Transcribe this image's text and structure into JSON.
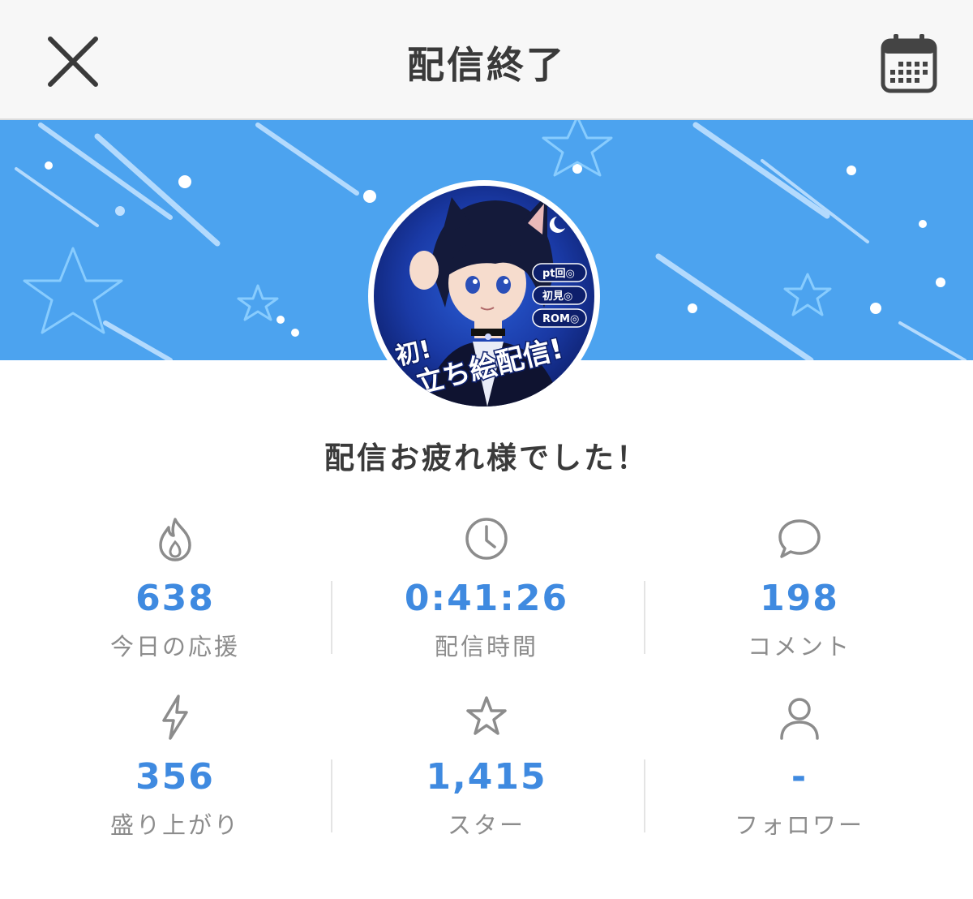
{
  "header": {
    "title": "配信終了",
    "close_icon": "close-icon",
    "calendar_icon": "calendar-icon"
  },
  "banner": {
    "background_color": "#4ca3ef",
    "avatar": {
      "badges": [
        "pt回◎",
        "初見◎",
        "ROM◎"
      ],
      "caption_line1": "初!",
      "caption_line2": "立ち絵配信!"
    }
  },
  "greeting": "配信お疲れ様でした！",
  "stats": [
    {
      "icon": "flame-icon",
      "value": "638",
      "label": "今日の応援"
    },
    {
      "icon": "clock-icon",
      "value": "0:41:26",
      "label": "配信時間"
    },
    {
      "icon": "comment-icon",
      "value": "198",
      "label": "コメント"
    },
    {
      "icon": "lightning-icon",
      "value": "356",
      "label": "盛り上がり"
    },
    {
      "icon": "star-icon",
      "value": "1,415",
      "label": "スター"
    },
    {
      "icon": "person-icon",
      "value": "-",
      "label": "フォロワー"
    }
  ],
  "colors": {
    "accent": "#3f8ae0",
    "label": "#8c8c8c",
    "title": "#3a3a3a",
    "header_bg": "#f7f7f7"
  }
}
